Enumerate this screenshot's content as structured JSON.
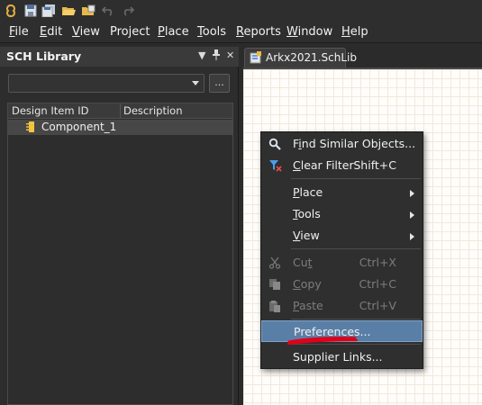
{
  "toolbar": {
    "icons": [
      "app-logo-icon",
      "save-icon",
      "save-all-icon",
      "open-folder-icon",
      "open-project-icon",
      "undo-icon",
      "redo-icon"
    ]
  },
  "menubar": {
    "items": [
      {
        "label": "File",
        "u": "F",
        "rest": "ile"
      },
      {
        "label": "Edit",
        "u": "E",
        "rest": "dit"
      },
      {
        "label": "View",
        "u": "V",
        "rest": "iew"
      },
      {
        "label": "Project",
        "u": "",
        "rest": "Project"
      },
      {
        "label": "Place",
        "u": "P",
        "rest": "lace"
      },
      {
        "label": "Tools",
        "u": "T",
        "rest": "ools"
      },
      {
        "label": "Reports",
        "u": "R",
        "rest": "eports"
      },
      {
        "label": "Window",
        "u": "W",
        "rest": "indow"
      },
      {
        "label": "Help",
        "u": "H",
        "rest": "elp"
      }
    ]
  },
  "panel": {
    "title": "SCH Library",
    "controls": {
      "menu": "▼",
      "pin": "📌",
      "close": "✕"
    },
    "filter_value": "",
    "browse_button": "...",
    "columns": [
      "Design Item ID",
      "Description"
    ],
    "rows": [
      {
        "id": "Component_1",
        "description": ""
      }
    ]
  },
  "document_tab": {
    "label": "Arkx2021.SchLib"
  },
  "context_menu": {
    "items": [
      {
        "label": "Find Similar Objects...",
        "u": "i",
        "shortcut": "",
        "icon": "search-icon",
        "submenu": false,
        "disabled": false
      },
      {
        "label": "Clear Filter",
        "u": "C",
        "shortcut": "Shift+C",
        "icon": "clear-filter-icon",
        "submenu": false,
        "disabled": false
      },
      {
        "label": "Place",
        "u": "P",
        "shortcut": "",
        "icon": "",
        "submenu": true,
        "disabled": false
      },
      {
        "label": "Tools",
        "u": "T",
        "shortcut": "",
        "icon": "",
        "submenu": true,
        "disabled": false
      },
      {
        "label": "View",
        "u": "V",
        "shortcut": "",
        "icon": "",
        "submenu": true,
        "disabled": false
      },
      {
        "label": "Cut",
        "u": "t",
        "shortcut": "Ctrl+X",
        "icon": "cut-icon",
        "submenu": false,
        "disabled": true
      },
      {
        "label": "Copy",
        "u": "C",
        "shortcut": "Ctrl+C",
        "icon": "copy-icon",
        "submenu": false,
        "disabled": true
      },
      {
        "label": "Paste",
        "u": "P",
        "shortcut": "Ctrl+V",
        "icon": "paste-icon",
        "submenu": false,
        "disabled": true
      },
      {
        "label": "Preferences...",
        "u": "",
        "shortcut": "",
        "icon": "",
        "submenu": false,
        "disabled": false,
        "highlighted": true
      },
      {
        "label": "Supplier Links...",
        "u": "",
        "shortcut": "",
        "icon": "",
        "submenu": false,
        "disabled": false
      }
    ]
  },
  "colors": {
    "background": "#2b2b2b",
    "menu_highlight": "#5a7fa6",
    "annotation_red": "#e0001a",
    "canvas_grid": "#f3e7db"
  }
}
